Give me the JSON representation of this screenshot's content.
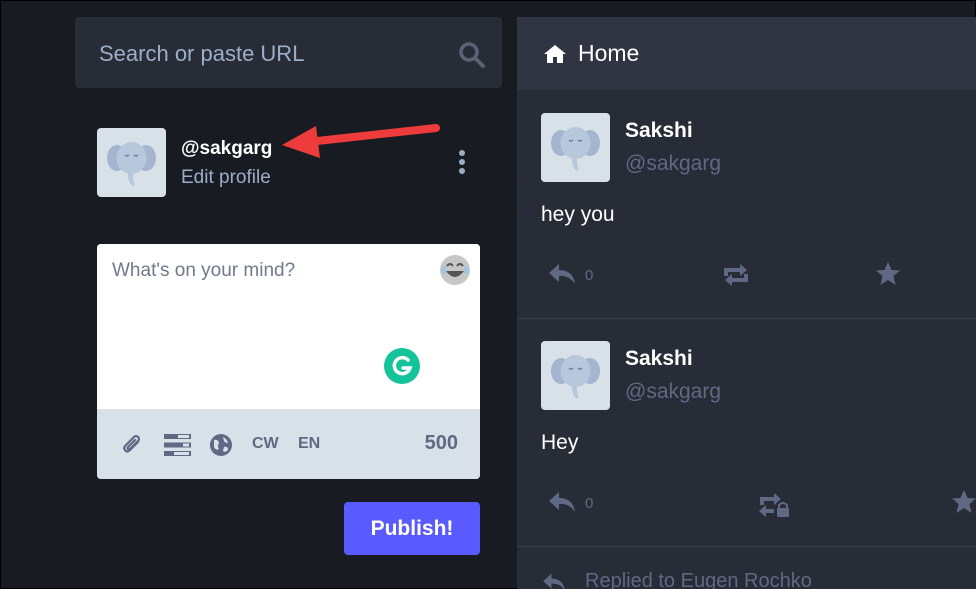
{
  "search": {
    "placeholder": "Search or paste URL"
  },
  "profile": {
    "handle": "@sakgarg",
    "edit_label": "Edit profile"
  },
  "composer": {
    "placeholder": "What's on your mind?",
    "cw_label": "CW",
    "lang_label": "EN",
    "char_count": "500",
    "publish_label": "Publish!"
  },
  "column": {
    "title": "Home",
    "statuses": [
      {
        "name": "Sakshi",
        "handle": "@sakgarg",
        "content": "hey you",
        "reply_count": "0"
      },
      {
        "name": "Sakshi",
        "handle": "@sakgarg",
        "content": "Hey",
        "reply_count": "0"
      }
    ],
    "partial_text": "Replied to Eugen Rochko"
  },
  "colors": {
    "background": "#191b22",
    "panel": "#282c37",
    "header": "#313543",
    "accent": "#595aff",
    "muted": "#606984",
    "annotation_arrow": "#ee3b3b"
  },
  "icons": [
    "search-icon",
    "elephant-avatar",
    "kebab-menu-icon",
    "emoji-icon",
    "grammarly-icon",
    "paperclip-icon",
    "poll-icon",
    "globe-icon",
    "home-icon",
    "reply-icon",
    "boost-icon",
    "boost-locked-icon",
    "star-icon"
  ]
}
